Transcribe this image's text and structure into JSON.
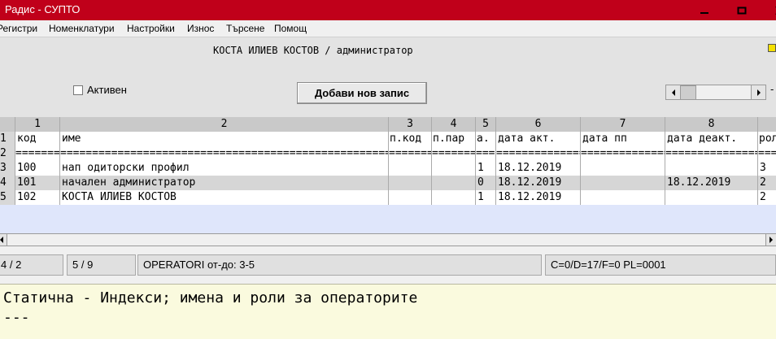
{
  "window": {
    "title": "Радис - СУПТО"
  },
  "menu": [
    "Регистри",
    "Номенклатури",
    "Настройки",
    "Износ",
    "Търсене",
    "Помощ"
  ],
  "operator_line": "КОСТА ИЛИЕВ КОСТОВ / администратор",
  "toolbar": {
    "active_label": "Активен",
    "active_checked": false,
    "add_button": "Добави нов запис"
  },
  "grid": {
    "col_numbers": [
      "1",
      "2",
      "3",
      "4",
      "5",
      "6",
      "7",
      "8",
      ""
    ],
    "col_names": [
      "код",
      "име",
      "п.код",
      "п.пар",
      "а.",
      "дата акт.",
      "дата пп",
      "дата деакт.",
      "роля"
    ],
    "row_numbers": [
      "1",
      "2",
      "3",
      "4",
      "5"
    ],
    "separator_char": "=",
    "rows": [
      [
        "100",
        "нап одиторски профил",
        "",
        "",
        "1",
        "18.12.2019",
        "",
        "",
        "3"
      ],
      [
        "101",
        "начален администратор",
        "",
        "",
        "0",
        "18.12.2019",
        "",
        "18.12.2019",
        "2"
      ],
      [
        "102",
        "КОСТА ИЛИЕВ КОСТОВ",
        "",
        "",
        "1",
        "18.12.2019",
        "",
        "",
        "2"
      ]
    ]
  },
  "status": {
    "pos": "4 / 2",
    "count": "5 / 9",
    "table": "OPERATORI от-до: 3-5",
    "flags": "C=0/D=17/F=0 PL=0001"
  },
  "description": {
    "line1": "Статична - Индекси; имена и роли за операторите",
    "line2": "---"
  }
}
